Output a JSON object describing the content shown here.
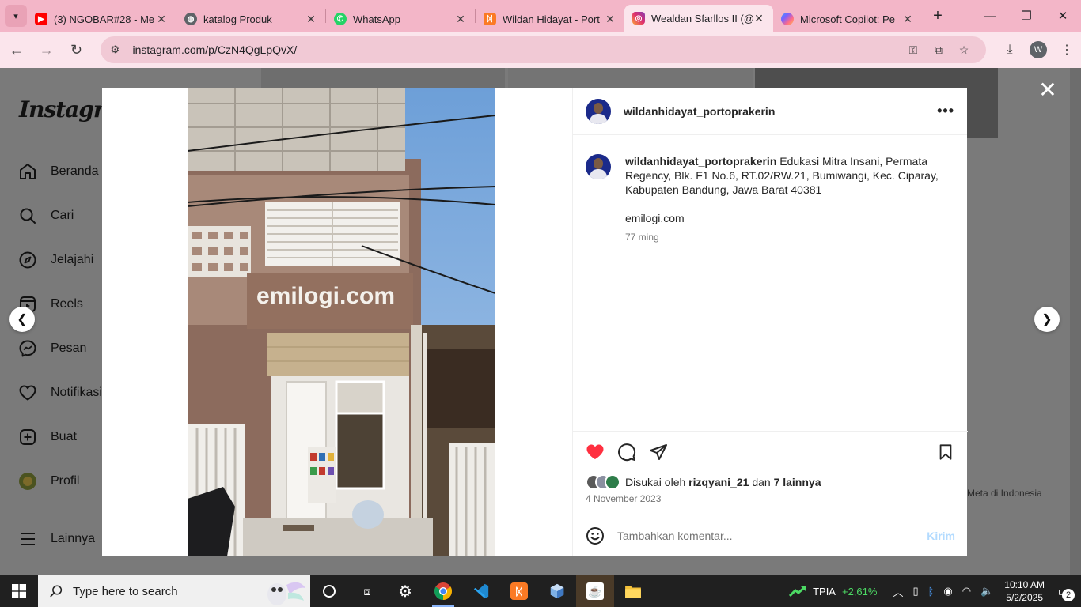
{
  "browser": {
    "tabs": [
      {
        "title": "(3) NGOBAR#28 - Me",
        "icon": "youtube-icon",
        "color": "#ff0000"
      },
      {
        "title": "katalog Produk",
        "icon": "globe-icon",
        "color": "#5f6368"
      },
      {
        "title": "WhatsApp",
        "icon": "whatsapp-icon",
        "color": "#25d366"
      },
      {
        "title": "Wildan Hidayat - Port",
        "icon": "xampp-icon",
        "color": "#fb7a24"
      },
      {
        "title": "Wealdan Sfarllos II (@",
        "icon": "instagram-icon",
        "color": "#e1306c"
      },
      {
        "title": "Microsoft Copilot: Pe",
        "icon": "copilot-icon",
        "color": "#7b61ff"
      }
    ],
    "url": "instagram.com/p/CzN4QgLpQvX/",
    "profile_initial": "W",
    "accent": "#f3b6c8"
  },
  "sidebar": {
    "logo": "Instagram",
    "items": [
      {
        "label": "Beranda",
        "icon": "home-icon"
      },
      {
        "label": "Cari",
        "icon": "search-icon"
      },
      {
        "label": "Jelajahi",
        "icon": "compass-icon"
      },
      {
        "label": "Reels",
        "icon": "reels-icon"
      },
      {
        "label": "Pesan",
        "icon": "messenger-icon"
      },
      {
        "label": "Notifikasi",
        "icon": "heart-icon"
      },
      {
        "label": "Buat",
        "icon": "plus-square-icon"
      },
      {
        "label": "Profil",
        "icon": "profile-avatar-icon"
      },
      {
        "label": "Lainnya",
        "icon": "menu-icon"
      }
    ]
  },
  "footer": {
    "meta": "Meta di Indonesia"
  },
  "post": {
    "username": "wildanhidayat_portoprakerin",
    "caption": "Edukasi Mitra Insani, Permata Regency, Blk. F1 No.6, RT.02/RW.21, Bumiwangi, Kec. Ciparay, Kabupaten Bandung, Jawa Barat 40381",
    "link": "emilogi.com",
    "caption_age": "77 ming",
    "sign_text": "emilogi.com",
    "likes_prefix": "Disukai oleh",
    "likes_user": "rizqyani_21",
    "likes_and": "dan",
    "likes_others": "7 lainnya",
    "date": "4 November 2023",
    "comment_placeholder": "Tambahkan komentar...",
    "send_label": "Kirim",
    "like_color": "#ff3040"
  },
  "taskbar": {
    "search_placeholder": "Type here to search",
    "stock_symbol": "TPIA",
    "stock_change": "+2,61%",
    "time": "10:10 AM",
    "date": "5/2/2025",
    "notifications": "2"
  }
}
